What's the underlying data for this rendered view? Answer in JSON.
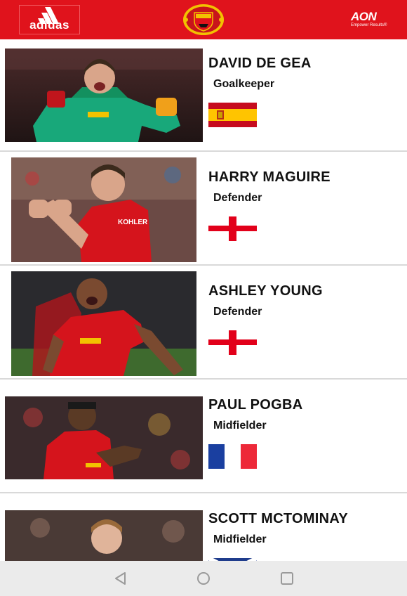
{
  "header": {
    "left_logo": "adidas",
    "center_logo": "MANCHESTER UNITED",
    "right_logo": "AON",
    "right_tagline": "Empower Results®"
  },
  "players": [
    {
      "name": "DAVID DE GEA",
      "position": "Goalkeeper",
      "flag": "spain-flag"
    },
    {
      "name": "HARRY MAGUIRE",
      "position": "Defender",
      "flag": "england-flag"
    },
    {
      "name": "ASHLEY YOUNG",
      "position": "Defender",
      "flag": "england-flag"
    },
    {
      "name": "PAUL POGBA",
      "position": "Midfielder",
      "flag": "france-flag"
    },
    {
      "name": "SCOTT MCTOMINAY",
      "position": "Midfielder",
      "flag": "scotland-flag"
    }
  ],
  "nav": {
    "back": "back-icon",
    "home": "home-icon",
    "recents": "recents-icon"
  },
  "colors": {
    "brand_red": "#e0131c",
    "nav_bg": "#ebebeb",
    "separator": "#d9d9d9"
  }
}
